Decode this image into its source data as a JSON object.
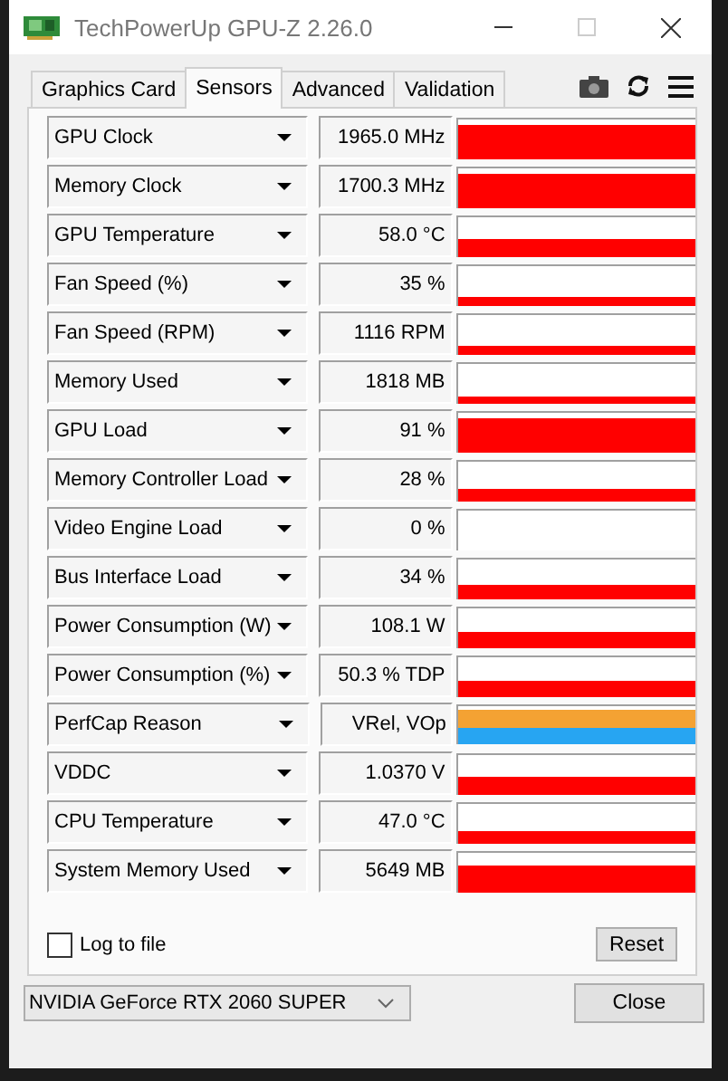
{
  "window": {
    "title": "TechPowerUp GPU-Z 2.26.0"
  },
  "tabs": [
    {
      "label": "Graphics Card",
      "selected": false
    },
    {
      "label": "Sensors",
      "selected": true
    },
    {
      "label": "Advanced",
      "selected": false
    },
    {
      "label": "Validation",
      "selected": false
    }
  ],
  "sensors": [
    {
      "name": "GPU Clock",
      "value": "1965.0 MHz",
      "kind": "graph"
    },
    {
      "name": "Memory Clock",
      "value": "1700.3 MHz",
      "kind": "graph"
    },
    {
      "name": "GPU Temperature",
      "value": "58.0 °C",
      "kind": "graph"
    },
    {
      "name": "Fan Speed (%)",
      "value": "35 %",
      "kind": "graph"
    },
    {
      "name": "Fan Speed (RPM)",
      "value": "1116 RPM",
      "kind": "graph"
    },
    {
      "name": "Memory Used",
      "value": "1818 MB",
      "kind": "graph"
    },
    {
      "name": "GPU Load",
      "value": "91 %",
      "kind": "graph"
    },
    {
      "name": "Memory Controller Load",
      "value": "28 %",
      "kind": "graph"
    },
    {
      "name": "Video Engine Load",
      "value": "0 %",
      "kind": "graph"
    },
    {
      "name": "Bus Interface Load",
      "value": "34 %",
      "kind": "graph"
    },
    {
      "name": "Power Consumption (W)",
      "value": "108.1 W",
      "kind": "graph"
    },
    {
      "name": "Power Consumption (%)",
      "value": "50.3 % TDP",
      "kind": "graph"
    },
    {
      "name": "PerfCap Reason",
      "value": "VRel, VOp",
      "kind": "bands"
    },
    {
      "name": "VDDC",
      "value": "1.0370 V",
      "kind": "graph"
    },
    {
      "name": "CPU Temperature",
      "value": "47.0 °C",
      "kind": "graph"
    },
    {
      "name": "System Memory Used",
      "value": "5649 MB",
      "kind": "graph"
    }
  ],
  "log_to_file": {
    "label": "Log to file",
    "checked": false
  },
  "reset_button": "Reset",
  "device_select": {
    "value": "NVIDIA GeForce RTX 2060 SUPER"
  },
  "close_button": "Close"
}
